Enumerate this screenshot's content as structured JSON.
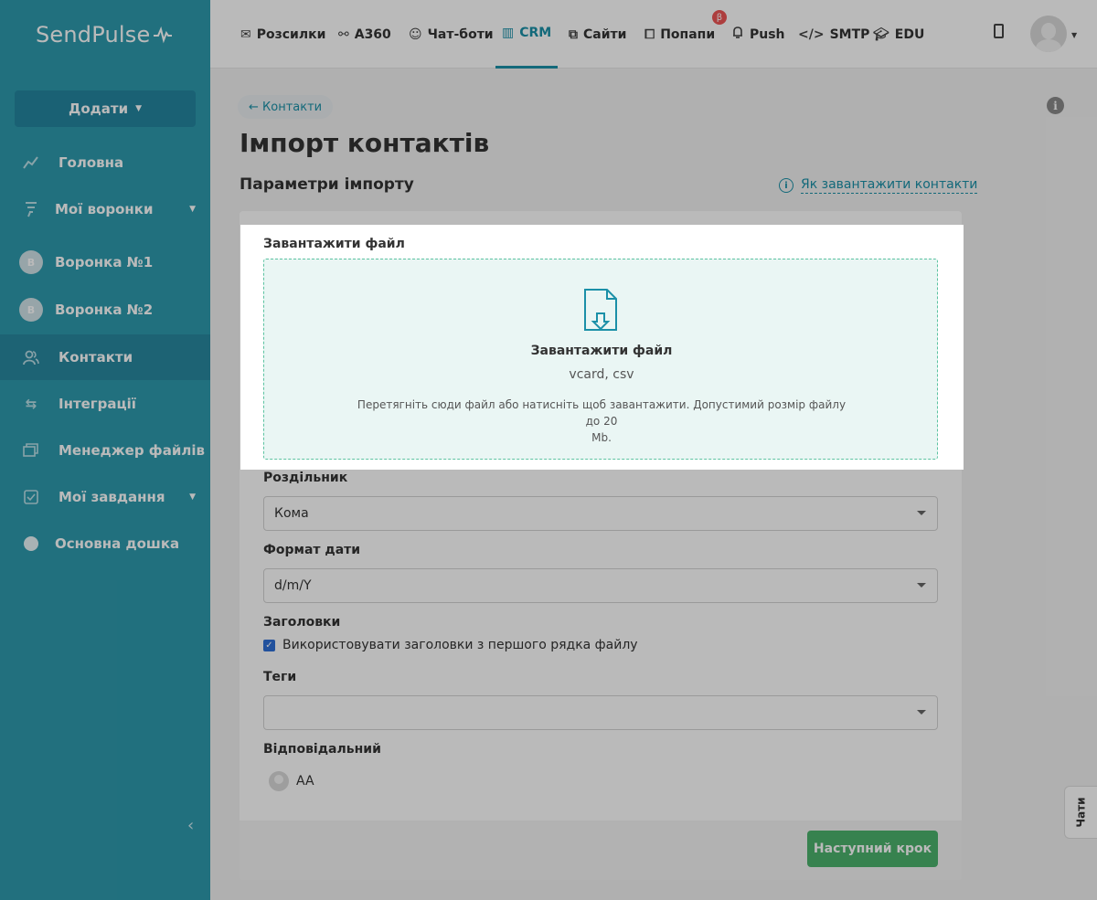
{
  "brand": {
    "logo_text": "SendPulse"
  },
  "sidebar": {
    "add_button": "Додати",
    "items": [
      {
        "label": "Головна",
        "icon": "trend-icon"
      },
      {
        "label": "Мої воронки",
        "icon": "funnel-icon"
      },
      {
        "label": "Воронка №1",
        "badge": "В"
      },
      {
        "label": "Воронка №2",
        "badge": "В"
      },
      {
        "label": "Контакти",
        "icon": "contacts-icon",
        "active": true
      },
      {
        "label": "Інтеграції",
        "icon": "integrations-icon"
      },
      {
        "label": "Менеджер файлів",
        "icon": "files-icon"
      },
      {
        "label": "Мої завдання",
        "icon": "tasks-icon"
      },
      {
        "label": "Основна дошка",
        "icon": "board-dot-icon"
      }
    ]
  },
  "topnav": {
    "items": [
      {
        "label": "Розсилки",
        "icon": "mail-icon"
      },
      {
        "label": "А360",
        "icon": "automation-icon"
      },
      {
        "label": "Чат-боти",
        "icon": "chatbot-icon"
      },
      {
        "label": "CRM",
        "icon": "crm-icon",
        "active": true
      },
      {
        "label": "Сайти",
        "icon": "sites-icon"
      },
      {
        "label": "Попапи",
        "icon": "popup-icon"
      },
      {
        "label": "Push",
        "icon": "bell-icon"
      },
      {
        "label": "SMTP",
        "icon": "code-icon"
      },
      {
        "label": "EDU",
        "icon": "graduation-icon"
      }
    ],
    "beta_badge": "β"
  },
  "page": {
    "back_link": "← Контакти",
    "title": "Імпорт контактів",
    "section_title": "Параметри імпорту",
    "help_link": "Як завантажити контакти"
  },
  "upload": {
    "label": "Завантажити файл",
    "title": "Завантажити файл",
    "formats": "vcard, csv",
    "hint_line1": "Перетягніть сюди файл або натисніть щоб завантажити. Допустимий розмір файлу до 20",
    "hint_line2": "Mb."
  },
  "form": {
    "separator_label": "Роздільник",
    "separator_value": "Кома",
    "date_format_label": "Формат дати",
    "date_format_value": "d/m/Y",
    "headers_label": "Заголовки",
    "headers_checkbox": "Використовувати заголовки з першого рядка файлу",
    "headers_checked": true,
    "tags_label": "Теги",
    "tags_value": "",
    "responsible_label": "Відповідальний",
    "responsible_value": "AA"
  },
  "actions": {
    "next_button": "Наступний крок"
  },
  "chats_tab": "Чати",
  "colors": {
    "sidebar": "#2e9aad",
    "accent": "#1b90a8",
    "next_button": "#4cb26d",
    "dropzone_bg": "#eaf6f4",
    "dropzone_border": "#5cc3a1"
  }
}
